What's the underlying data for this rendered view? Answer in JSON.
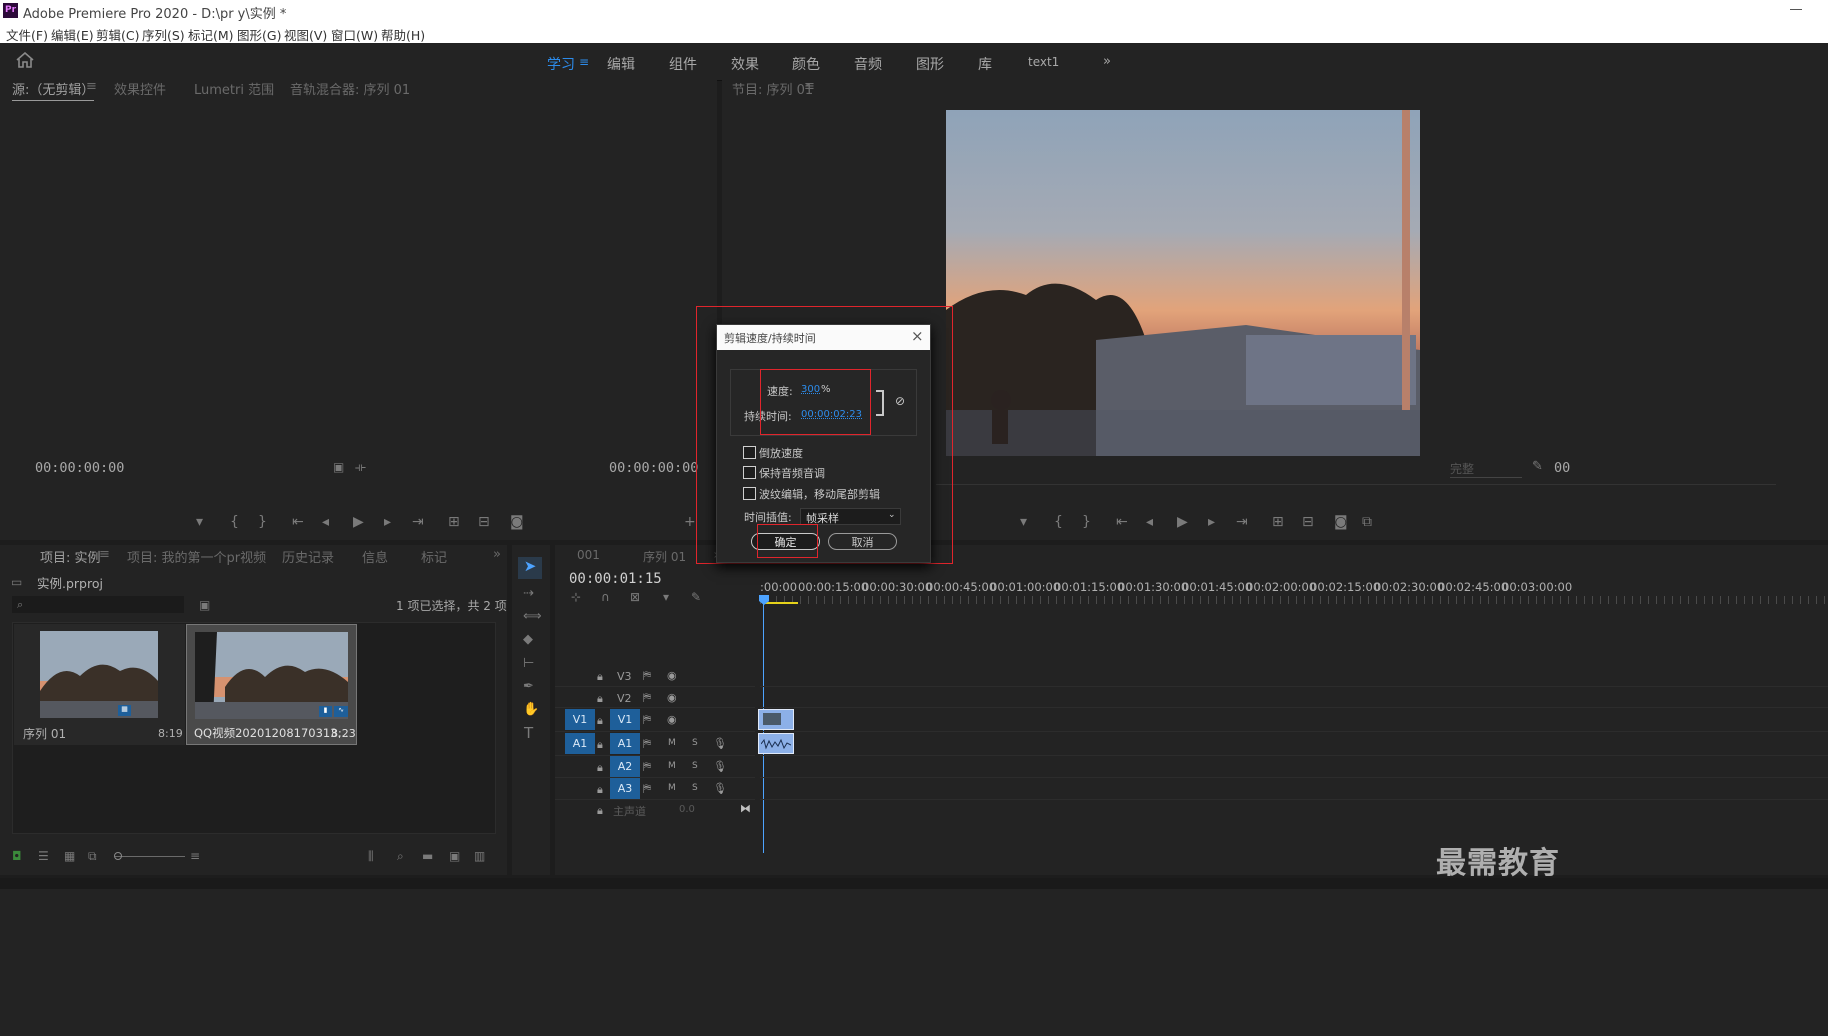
{
  "titlebar": {
    "app_icon": "Pr",
    "title": "Adobe Premiere Pro 2020 - D:\\pr y\\实例 *"
  },
  "menu": [
    "文件(F)",
    "编辑(E)",
    "剪辑(C)",
    "序列(S)",
    "标记(M)",
    "图形(G)",
    "视图(V)",
    "窗口(W)",
    "帮助(H)"
  ],
  "workspaces": {
    "items": [
      "学习",
      "编辑",
      "组件",
      "效果",
      "颜色",
      "音频",
      "图形",
      "库",
      "text1"
    ],
    "active": "学习",
    "accent": "#2d8ceb"
  },
  "source_panel": {
    "tabs": [
      "源:（无剪辑）",
      "效果控件",
      "Lumetri 范围",
      "音轨混合器: 序列 01"
    ],
    "timecode_left": "00:00:00:00",
    "timecode_right": "00:00:00:00"
  },
  "program_panel": {
    "tab": "节目: 序列 01",
    "fit_label": "完整",
    "timecode_right": "00"
  },
  "project_panel": {
    "tabs": [
      "项目: 实例",
      "项目: 我的第一个pr视频",
      "历史记录",
      "信息",
      "标记"
    ],
    "project_file": "实例.prproj",
    "selection_info": "1 项已选择，共 2 项",
    "items": [
      {
        "name": "序列 01",
        "duration": "8:19"
      },
      {
        "name": "QQ视频20201208170313...",
        "duration": "8;23"
      }
    ]
  },
  "timeline_panel": {
    "tabs": [
      "001",
      "序列 01"
    ],
    "timecode": "00:00:01:15",
    "ruler": [
      ":00:00",
      "00:00:15:00",
      "00:00:30:00",
      "00:00:45:00",
      "00:01:00:00",
      "00:01:15:00",
      "00:01:30:00",
      "00:01:45:00",
      "00:02:00:00",
      "00:02:15:00",
      "00:02:30:00",
      "00:02:45:00",
      "00:03:00:00"
    ],
    "video_tracks": [
      "V3",
      "V2",
      "V1"
    ],
    "audio_tracks": [
      "A1",
      "A2",
      "A3"
    ],
    "source_patch_v": "V1",
    "source_patch_a": "A1",
    "master_label": "主声道",
    "master_value": "0.0",
    "mute_label": "M",
    "solo_label": "S"
  },
  "dialog": {
    "title": "剪辑速度/持续时间",
    "speed_label": "速度:",
    "speed_value": "300",
    "speed_unit": "%",
    "duration_label": "持续时间:",
    "duration_value": "00:00:02:23",
    "reverse_label": "倒放速度",
    "keep_pitch_label": "保持音频音调",
    "ripple_label": "波纹编辑，移动尾部剪辑",
    "interp_label": "时间插值:",
    "interp_value": "帧采样",
    "ok_label": "确定",
    "cancel_label": "取消",
    "value_color": "#2d8ceb",
    "highlight_color": "#e0252c"
  },
  "watermark": "最需教育"
}
